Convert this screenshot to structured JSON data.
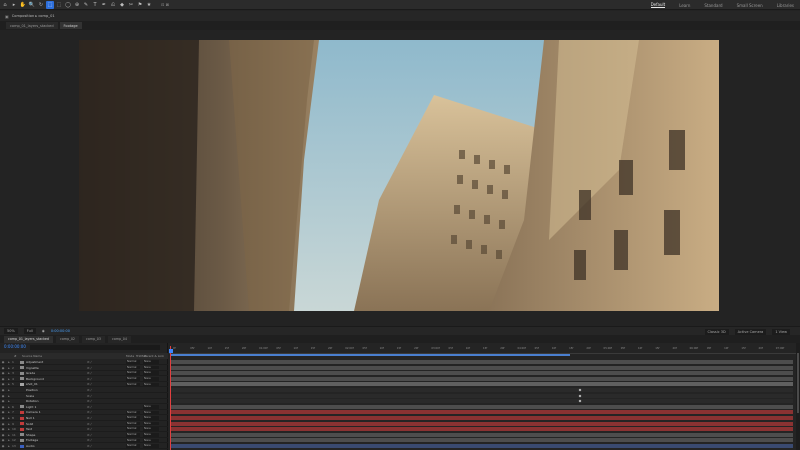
{
  "toolbar": {
    "tools": [
      "⌂",
      "▸",
      "✋",
      "🔍",
      "↻",
      "⬚",
      "⬚",
      "◯",
      "⊕",
      "✎",
      "T",
      "✒",
      "⎌",
      "◆",
      "✂",
      "⚑",
      "★"
    ],
    "active_index": 5,
    "snapping_label": "⊡ ⊠",
    "workspaces": [
      "Default",
      "Learn",
      "Standard",
      "Small Screen",
      "Libraries"
    ],
    "active_workspace": 0
  },
  "comp_panel": {
    "title": "Composition ▸ comp_01",
    "tabs": [
      "comp_01_layers_stacked",
      "Footage"
    ],
    "active_tab": 1
  },
  "view_bar": {
    "zoom": "50%",
    "resolution": "Full",
    "timecode": "0:00:00:00",
    "renderer": "Classic 3D",
    "camera": "Active Camera",
    "views": "1 View"
  },
  "timeline": {
    "tabs": [
      "comp_01_layers_stacked",
      "comp_02",
      "comp_03",
      "comp_04"
    ],
    "active_tab": 0,
    "current_time": "0:00:00:00",
    "search_placeholder": "",
    "columns": [
      "#",
      "Source Name",
      "Mode",
      "TrkMat",
      "Parent & Link"
    ],
    "ruler_ticks": [
      "0f",
      "05f",
      "10f",
      "15f",
      "20f",
      "01:00f",
      "05f",
      "10f",
      "15f",
      "20f",
      "02:00f",
      "05f",
      "10f",
      "15f",
      "20f",
      "03:00f",
      "05f",
      "10f",
      "15f",
      "20f",
      "04:00f",
      "05f",
      "10f",
      "15f",
      "20f",
      "05:00f",
      "05f",
      "10f",
      "15f",
      "20f",
      "06:00f",
      "05f",
      "10f",
      "15f",
      "20f",
      "07:00f"
    ],
    "layers": [
      {
        "num": "1",
        "name": "Adjustment",
        "color": "#8a8a8a",
        "mode": "Normal",
        "parent": "None",
        "bar": "#4d4d4d"
      },
      {
        "num": "2",
        "name": "Vignette",
        "color": "#8a8a8a",
        "mode": "Normal",
        "parent": "None",
        "bar": "#4d4d4d"
      },
      {
        "num": "3",
        "name": "Grade",
        "color": "#8a8a8a",
        "mode": "Normal",
        "parent": "None",
        "bar": "#4d4d4d"
      },
      {
        "num": "4",
        "name": "Background",
        "color": "#8a8a8a",
        "mode": "Normal",
        "parent": "None",
        "bar": "#4d4d4d"
      },
      {
        "num": "5",
        "name": "shot_01",
        "color": "#a7a7a7",
        "mode": "Normal",
        "parent": "None",
        "bar": "#606060"
      },
      {
        "num": "",
        "name": "Position",
        "color": "",
        "mode": "",
        "parent": "",
        "bar": "#2a2a2a"
      },
      {
        "num": "",
        "name": "Scale",
        "color": "",
        "mode": "",
        "parent": "",
        "bar": "#2a2a2a"
      },
      {
        "num": "",
        "name": "Rotation",
        "color": "",
        "mode": "",
        "parent": "",
        "bar": "#2a2a2a"
      },
      {
        "num": "6",
        "name": "Light 1",
        "color": "#8a8a8a",
        "mode": "",
        "parent": "None",
        "bar": "#4d4d4d"
      },
      {
        "num": "7",
        "name": "Camera 1",
        "color": "#c23b3b",
        "mode": "Normal",
        "parent": "None",
        "bar": "#8a3232"
      },
      {
        "num": "8",
        "name": "Null 1",
        "color": "#c23b3b",
        "mode": "Normal",
        "parent": "None",
        "bar": "#8a3232"
      },
      {
        "num": "9",
        "name": "Solid",
        "color": "#c23b3b",
        "mode": "Normal",
        "parent": "None",
        "bar": "#8a3232"
      },
      {
        "num": "10",
        "name": "Text",
        "color": "#c23b3b",
        "mode": "Normal",
        "parent": "None",
        "bar": "#8a3232"
      },
      {
        "num": "11",
        "name": "Shape",
        "color": "#8a8a8a",
        "mode": "Normal",
        "parent": "None",
        "bar": "#4d4d4d"
      },
      {
        "num": "12",
        "name": "Footage",
        "color": "#8a8a8a",
        "mode": "Normal",
        "parent": "None",
        "bar": "#4d4d4d"
      },
      {
        "num": "13",
        "name": "Audio",
        "color": "#3a5fbf",
        "mode": "Normal",
        "parent": "None",
        "bar": "#3a4a70"
      }
    ]
  },
  "colors": {
    "accent": "#2d6fdb",
    "playhead": "#e04040",
    "timecode": "#3d8bff"
  }
}
